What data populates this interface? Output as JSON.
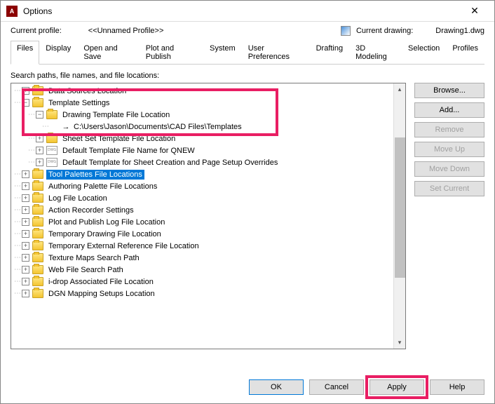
{
  "window": {
    "title": "Options"
  },
  "profile": {
    "label": "Current profile:",
    "value": "<<Unnamed Profile>>"
  },
  "drawing": {
    "label": "Current drawing:",
    "value": "Drawing1.dwg"
  },
  "tabs": [
    "Files",
    "Display",
    "Open and Save",
    "Plot and Publish",
    "System",
    "User Preferences",
    "Drafting",
    "3D Modeling",
    "Selection",
    "Profiles"
  ],
  "active_tab": 0,
  "search_label": "Search paths, file names, and file locations:",
  "tree": [
    {
      "indent": 0,
      "exp": "+",
      "icon": "folder",
      "label": "Data Sources Location"
    },
    {
      "indent": 0,
      "exp": "-",
      "icon": "folder",
      "label": "Template Settings"
    },
    {
      "indent": 1,
      "exp": "-",
      "icon": "folder",
      "label": "Drawing Template File Location"
    },
    {
      "indent": 2,
      "exp": "",
      "icon": "arrow",
      "label": "C:\\Users\\Jason\\Documents\\CAD Files\\Templates"
    },
    {
      "indent": 1,
      "exp": "+",
      "icon": "folder",
      "label": "Sheet Set Template File Location"
    },
    {
      "indent": 1,
      "exp": "+",
      "icon": "doc",
      "label": "Default Template File Name for QNEW"
    },
    {
      "indent": 1,
      "exp": "+",
      "icon": "doc",
      "label": "Default Template for Sheet Creation and Page Setup Overrides"
    },
    {
      "indent": 0,
      "exp": "+",
      "icon": "folder",
      "label": "Tool Palettes File Locations",
      "selected": true
    },
    {
      "indent": 0,
      "exp": "+",
      "icon": "folder",
      "label": "Authoring Palette File Locations"
    },
    {
      "indent": 0,
      "exp": "+",
      "icon": "folder",
      "label": "Log File Location"
    },
    {
      "indent": 0,
      "exp": "+",
      "icon": "folder",
      "label": "Action Recorder Settings"
    },
    {
      "indent": 0,
      "exp": "+",
      "icon": "folder",
      "label": "Plot and Publish Log File Location"
    },
    {
      "indent": 0,
      "exp": "+",
      "icon": "folder",
      "label": "Temporary Drawing File Location"
    },
    {
      "indent": 0,
      "exp": "+",
      "icon": "folder",
      "label": "Temporary External Reference File Location"
    },
    {
      "indent": 0,
      "exp": "+",
      "icon": "folder",
      "label": "Texture Maps Search Path"
    },
    {
      "indent": 0,
      "exp": "+",
      "icon": "folder",
      "label": "Web File Search Path"
    },
    {
      "indent": 0,
      "exp": "+",
      "icon": "folder",
      "label": "i-drop Associated File Location"
    },
    {
      "indent": 0,
      "exp": "+",
      "icon": "folder",
      "label": "DGN Mapping Setups Location"
    }
  ],
  "side_buttons": [
    {
      "label": "Browse...",
      "enabled": true
    },
    {
      "label": "Add...",
      "enabled": true
    },
    {
      "label": "Remove",
      "enabled": false
    },
    {
      "label": "Move Up",
      "enabled": false
    },
    {
      "label": "Move Down",
      "enabled": false
    },
    {
      "label": "Set Current",
      "enabled": false
    }
  ],
  "bottom_buttons": {
    "ok": "OK",
    "cancel": "Cancel",
    "apply": "Apply",
    "help": "Help"
  }
}
